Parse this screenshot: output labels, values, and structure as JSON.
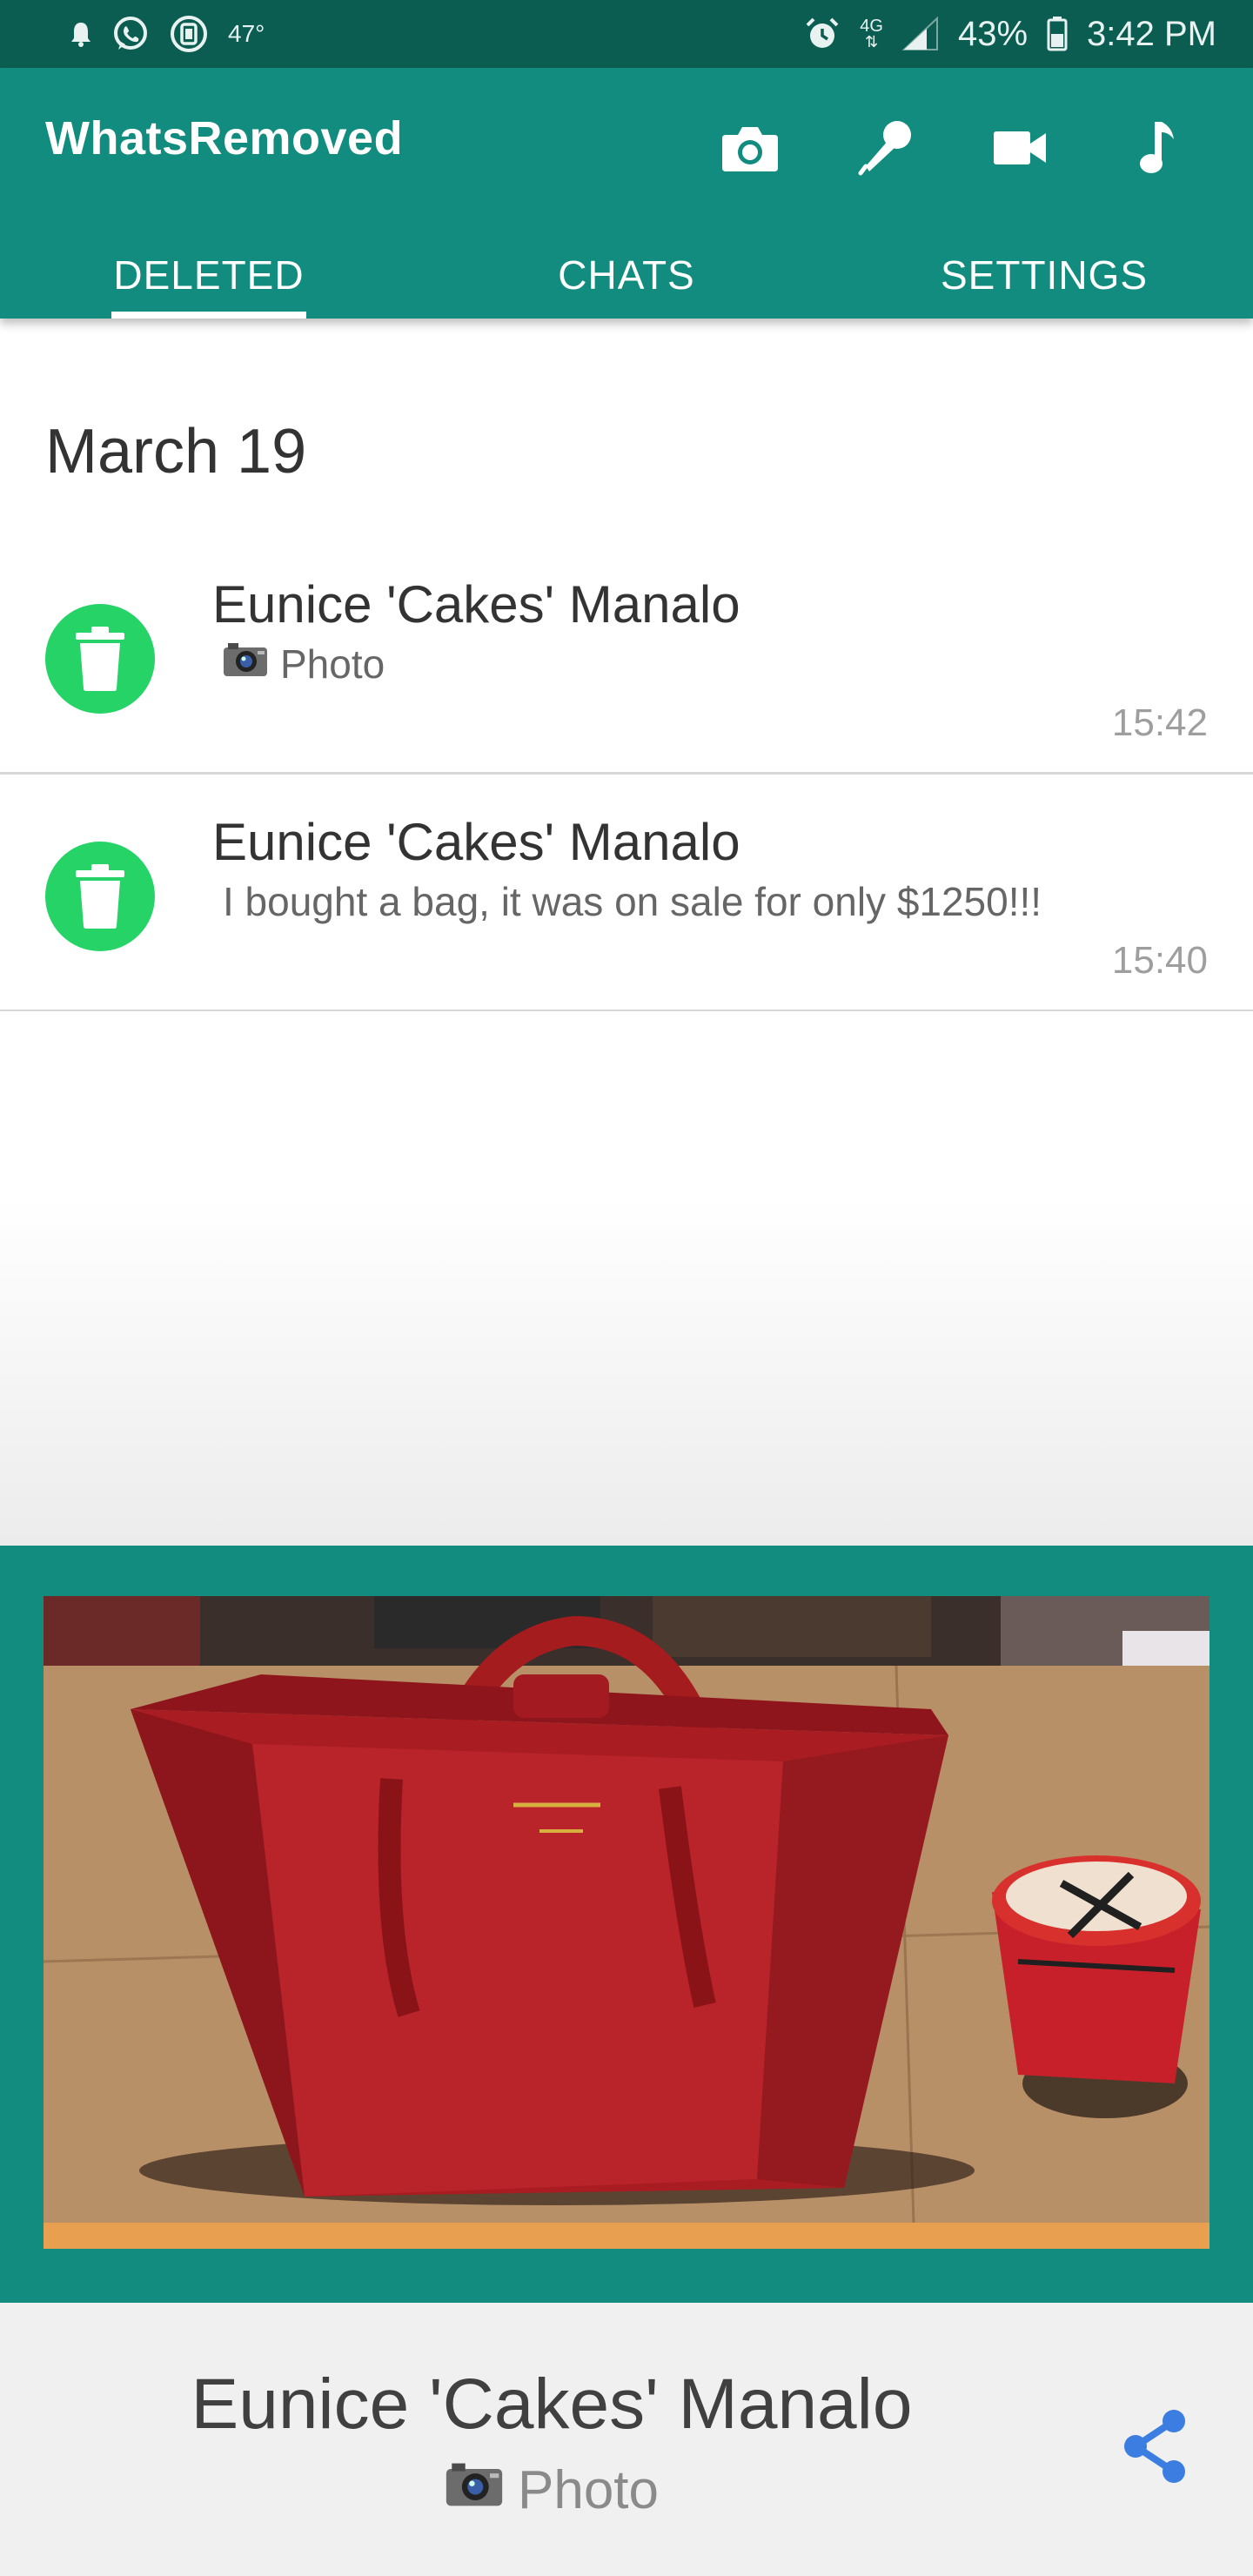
{
  "status_bar": {
    "temperature": "47°",
    "network_label": "4G",
    "battery": "43%",
    "time": "3:42 PM",
    "icons": [
      "notification-bell-icon",
      "whatsapp-icon",
      "app-notification-icon",
      "alarm-icon",
      "network-4g-icon",
      "signal-icon",
      "battery-icon"
    ]
  },
  "app_bar": {
    "title": "WhatsRemoved",
    "actions": [
      "camera-icon",
      "microphone-icon",
      "video-icon",
      "music-note-icon"
    ]
  },
  "tabs": [
    {
      "label": "DELETED",
      "active": true
    },
    {
      "label": "CHATS",
      "active": false
    },
    {
      "label": "SETTINGS",
      "active": false
    }
  ],
  "list": {
    "date_header": "March 19",
    "items": [
      {
        "sender": "Eunice 'Cakes' Manalo",
        "message": "Photo",
        "has_photo_icon": true,
        "time": "15:42"
      },
      {
        "sender": "Eunice 'Cakes' Manalo",
        "message": "I bought a bag, it was on sale for only $1250!!!",
        "has_photo_icon": false,
        "time": "15:40"
      }
    ]
  },
  "preview": {
    "image_subject": "red handbag on table"
  },
  "bottom": {
    "sender": "Eunice 'Cakes' Manalo",
    "subtitle": "Photo"
  },
  "colors": {
    "status_bar": "#0c5d51",
    "primary": "#128c7e",
    "avatar": "#25d366",
    "share": "#3b7de0"
  }
}
